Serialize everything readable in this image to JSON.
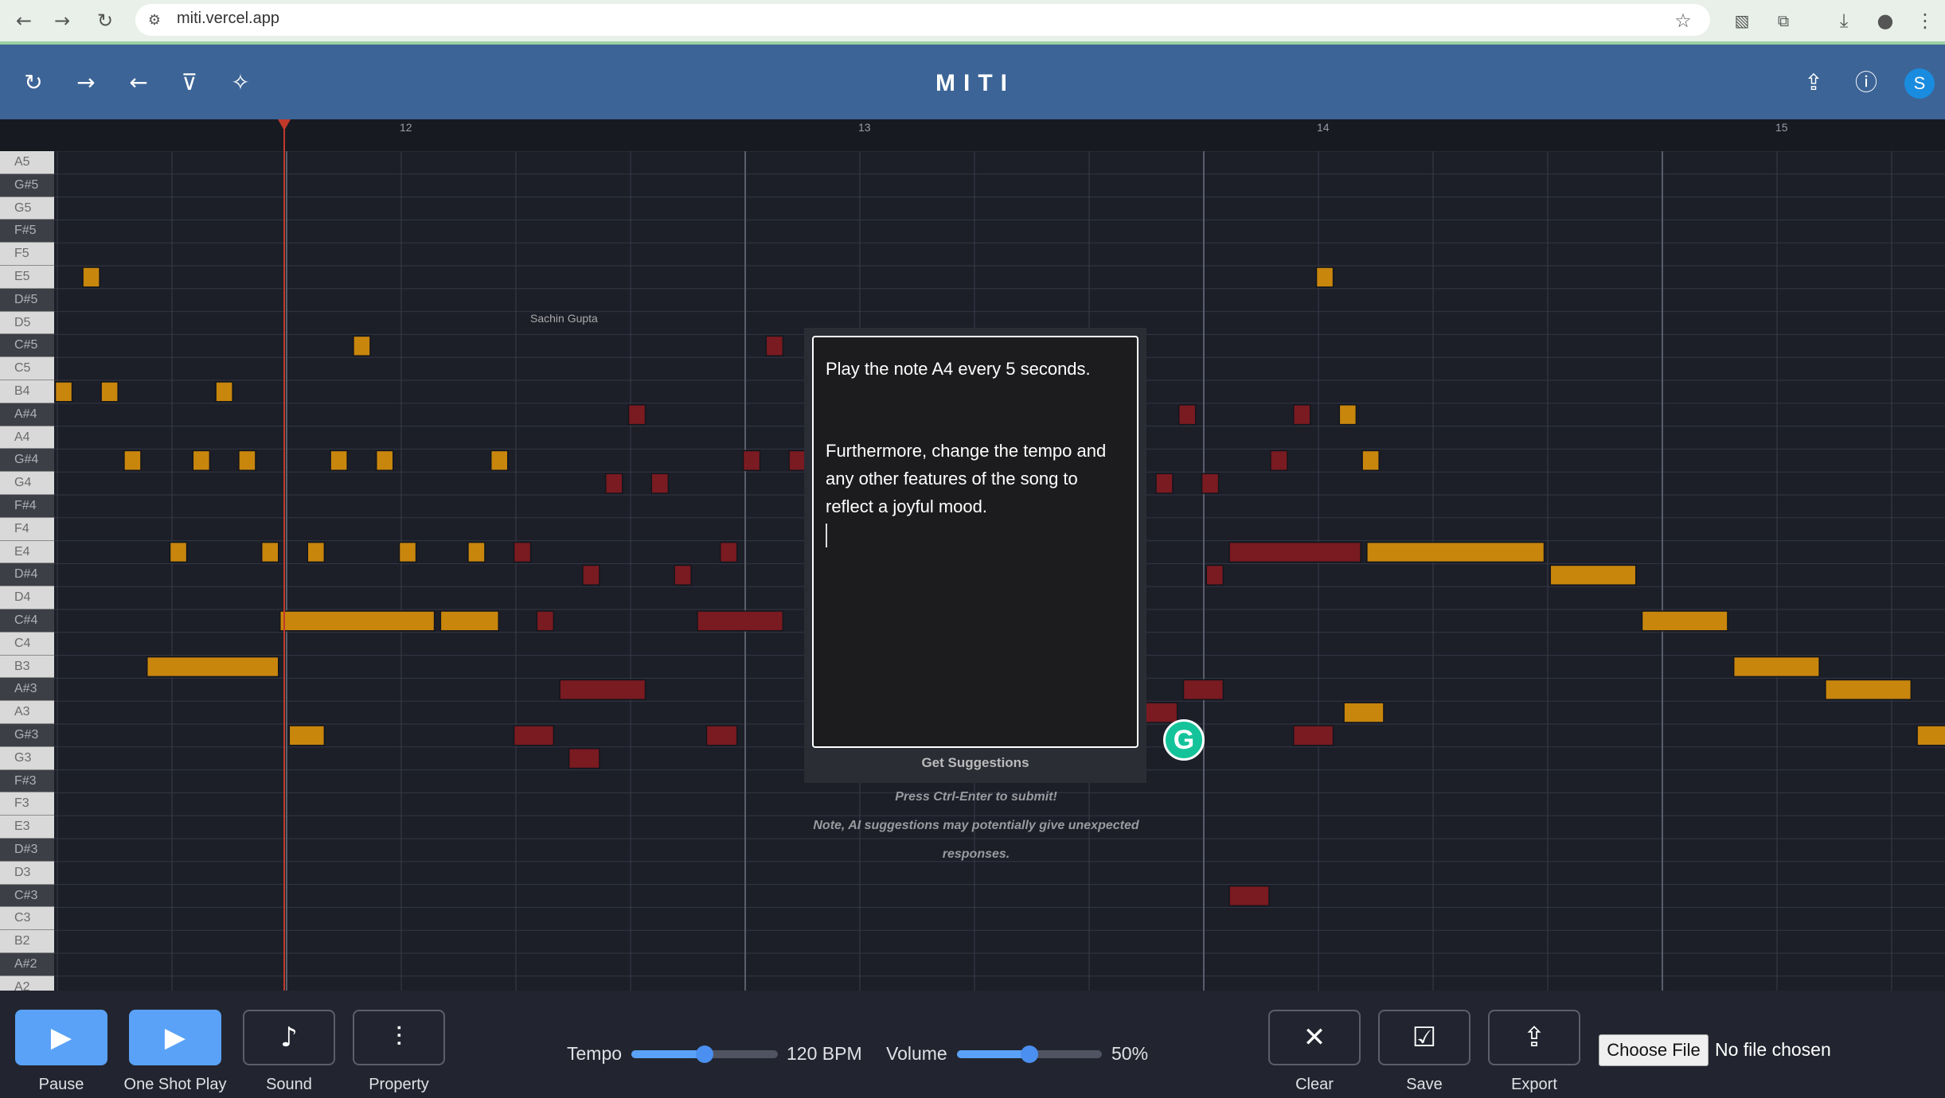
{
  "browser": {
    "url": "miti.vercel.app",
    "icons": [
      "back-icon",
      "forward-icon",
      "reload-icon",
      "site-info-icon",
      "star-icon",
      "extension-icon",
      "puzzle-icon",
      "download-icon",
      "profile-icon",
      "menu-icon"
    ]
  },
  "header": {
    "title": "MITI",
    "left_icons": [
      "refresh-icon",
      "redo-icon",
      "undo-icon",
      "filter-icon",
      "magic-icon"
    ],
    "right_icons": [
      "share-icon",
      "info-icon"
    ],
    "avatar_letter": "S"
  },
  "roll": {
    "bar_labels": [
      "12",
      "13",
      "14",
      "15"
    ],
    "notes": [
      "A5",
      "G#5",
      "G5",
      "F#5",
      "F5",
      "E5",
      "D#5",
      "D5",
      "C#5",
      "C5",
      "B4",
      "A#4",
      "A4",
      "G#4",
      "G4",
      "F#4",
      "F4",
      "E4",
      "D#4",
      "D4",
      "C#4",
      "C4",
      "B3",
      "A#3",
      "A3",
      "G#3",
      "G3",
      "F#3",
      "F3",
      "E3",
      "D#3",
      "D3",
      "C#3",
      "C3",
      "B2",
      "A#2",
      "A2"
    ],
    "author_tag": "Sachin Gupta",
    "colors": {
      "gold": "#c8860d",
      "red": "#7a1a21"
    },
    "note_blocks": [
      {
        "row": 5,
        "start": 0.8,
        "len": 0.4,
        "c": "gold"
      },
      {
        "row": 10,
        "start": 0.2,
        "len": 0.4,
        "c": "gold"
      },
      {
        "row": 10,
        "start": 1.2,
        "len": 0.4,
        "c": "gold"
      },
      {
        "row": 10,
        "start": 3.7,
        "len": 0.4,
        "c": "gold"
      },
      {
        "row": 8,
        "start": 6.7,
        "len": 0.4,
        "c": "gold"
      },
      {
        "row": 13,
        "start": 1.7,
        "len": 0.4,
        "c": "gold"
      },
      {
        "row": 13,
        "start": 3.2,
        "len": 0.4,
        "c": "gold"
      },
      {
        "row": 13,
        "start": 4.2,
        "len": 0.4,
        "c": "gold"
      },
      {
        "row": 13,
        "start": 6.2,
        "len": 0.4,
        "c": "gold"
      },
      {
        "row": 13,
        "start": 7.2,
        "len": 0.4,
        "c": "gold"
      },
      {
        "row": 13,
        "start": 9.7,
        "len": 0.4,
        "c": "gold"
      },
      {
        "row": 17,
        "start": 2.7,
        "len": 0.4,
        "c": "gold"
      },
      {
        "row": 17,
        "start": 4.7,
        "len": 0.4,
        "c": "gold"
      },
      {
        "row": 17,
        "start": 5.7,
        "len": 0.4,
        "c": "gold"
      },
      {
        "row": 17,
        "start": 7.7,
        "len": 0.4,
        "c": "gold"
      },
      {
        "row": 17,
        "start": 9.2,
        "len": 0.4,
        "c": "gold"
      },
      {
        "row": 22,
        "start": 2.2,
        "len": 2.9,
        "c": "gold"
      },
      {
        "row": 20,
        "start": 5.1,
        "len": 3.4,
        "c": "gold"
      },
      {
        "row": 20,
        "start": 8.6,
        "len": 1.3,
        "c": "gold"
      },
      {
        "row": 25,
        "start": 5.3,
        "len": 0.8,
        "c": "gold"
      },
      {
        "row": 17,
        "start": 10.2,
        "len": 0.4,
        "c": "red"
      },
      {
        "row": 20,
        "start": 10.7,
        "len": 0.4,
        "c": "red"
      },
      {
        "row": 18,
        "start": 11.7,
        "len": 0.4,
        "c": "red"
      },
      {
        "row": 14,
        "start": 12.2,
        "len": 0.4,
        "c": "red"
      },
      {
        "row": 11,
        "start": 12.7,
        "len": 0.4,
        "c": "red"
      },
      {
        "row": 14,
        "start": 13.2,
        "len": 0.4,
        "c": "red"
      },
      {
        "row": 18,
        "start": 13.7,
        "len": 0.4,
        "c": "red"
      },
      {
        "row": 17,
        "start": 14.7,
        "len": 0.4,
        "c": "red"
      },
      {
        "row": 13,
        "start": 15.2,
        "len": 0.4,
        "c": "red"
      },
      {
        "row": 8,
        "start": 15.7,
        "len": 0.4,
        "c": "red"
      },
      {
        "row": 13,
        "start": 16.2,
        "len": 0.4,
        "c": "red"
      },
      {
        "row": 20,
        "start": 14.2,
        "len": 1.9,
        "c": "red"
      },
      {
        "row": 23,
        "start": 11.2,
        "len": 1.9,
        "c": "red"
      },
      {
        "row": 25,
        "start": 10.2,
        "len": 0.9,
        "c": "red"
      },
      {
        "row": 26,
        "start": 11.4,
        "len": 0.7,
        "c": "red"
      },
      {
        "row": 25,
        "start": 14.4,
        "len": 0.7,
        "c": "red"
      },
      {
        "row": 24,
        "start": 23.8,
        "len": 0.9,
        "c": "red"
      },
      {
        "row": 23,
        "start": 24.8,
        "len": 0.9,
        "c": "red"
      },
      {
        "row": 18,
        "start": 25.3,
        "len": 0.4,
        "c": "red"
      },
      {
        "row": 17,
        "start": 25.8,
        "len": 2.9,
        "c": "red"
      },
      {
        "row": 11,
        "start": 24.7,
        "len": 0.4,
        "c": "red"
      },
      {
        "row": 14,
        "start": 24.2,
        "len": 0.4,
        "c": "red"
      },
      {
        "row": 14,
        "start": 25.2,
        "len": 0.4,
        "c": "red"
      },
      {
        "row": 13,
        "start": 26.7,
        "len": 0.4,
        "c": "red"
      },
      {
        "row": 11,
        "start": 27.2,
        "len": 0.4,
        "c": "red"
      },
      {
        "row": 25,
        "start": 27.2,
        "len": 0.9,
        "c": "red"
      },
      {
        "row": 32,
        "start": 25.8,
        "len": 0.9,
        "c": "red"
      },
      {
        "row": 5,
        "start": 27.7,
        "len": 0.4,
        "c": "gold"
      },
      {
        "row": 11,
        "start": 28.2,
        "len": 0.4,
        "c": "gold"
      },
      {
        "row": 13,
        "start": 28.7,
        "len": 0.4,
        "c": "gold"
      },
      {
        "row": 17,
        "start": 28.8,
        "len": 3.9,
        "c": "gold"
      },
      {
        "row": 18,
        "start": 32.8,
        "len": 1.9,
        "c": "gold"
      },
      {
        "row": 20,
        "start": 34.8,
        "len": 1.9,
        "c": "gold"
      },
      {
        "row": 22,
        "start": 36.8,
        "len": 1.9,
        "c": "gold"
      },
      {
        "row": 23,
        "start": 38.8,
        "len": 1.9,
        "c": "gold"
      },
      {
        "row": 24,
        "start": 28.3,
        "len": 0.9,
        "c": "gold"
      },
      {
        "row": 25,
        "start": 40.8,
        "len": 0.9,
        "c": "gold"
      }
    ]
  },
  "dialog": {
    "line1": "Play the note A4 every 5 seconds.",
    "line2": "Furthermore, change the tempo and any other features of the song to reflect a joyful mood.",
    "button": "Get Suggestions",
    "hint1": "Press Ctrl-Enter to submit!",
    "hint2": "Note, AI suggestions may potentially give unexpected",
    "hint3": "responses."
  },
  "controls": {
    "pause": "Pause",
    "one_shot": "One Shot Play",
    "sound": "Sound",
    "property": "Property",
    "tempo_label": "Tempo",
    "tempo_value": "120 BPM",
    "tempo_fraction": 0.5,
    "volume_label": "Volume",
    "volume_value": "50%",
    "volume_fraction": 0.5,
    "clear": "Clear",
    "save": "Save",
    "export": "Export",
    "choose_file": "Choose File",
    "no_file": "No file chosen"
  }
}
